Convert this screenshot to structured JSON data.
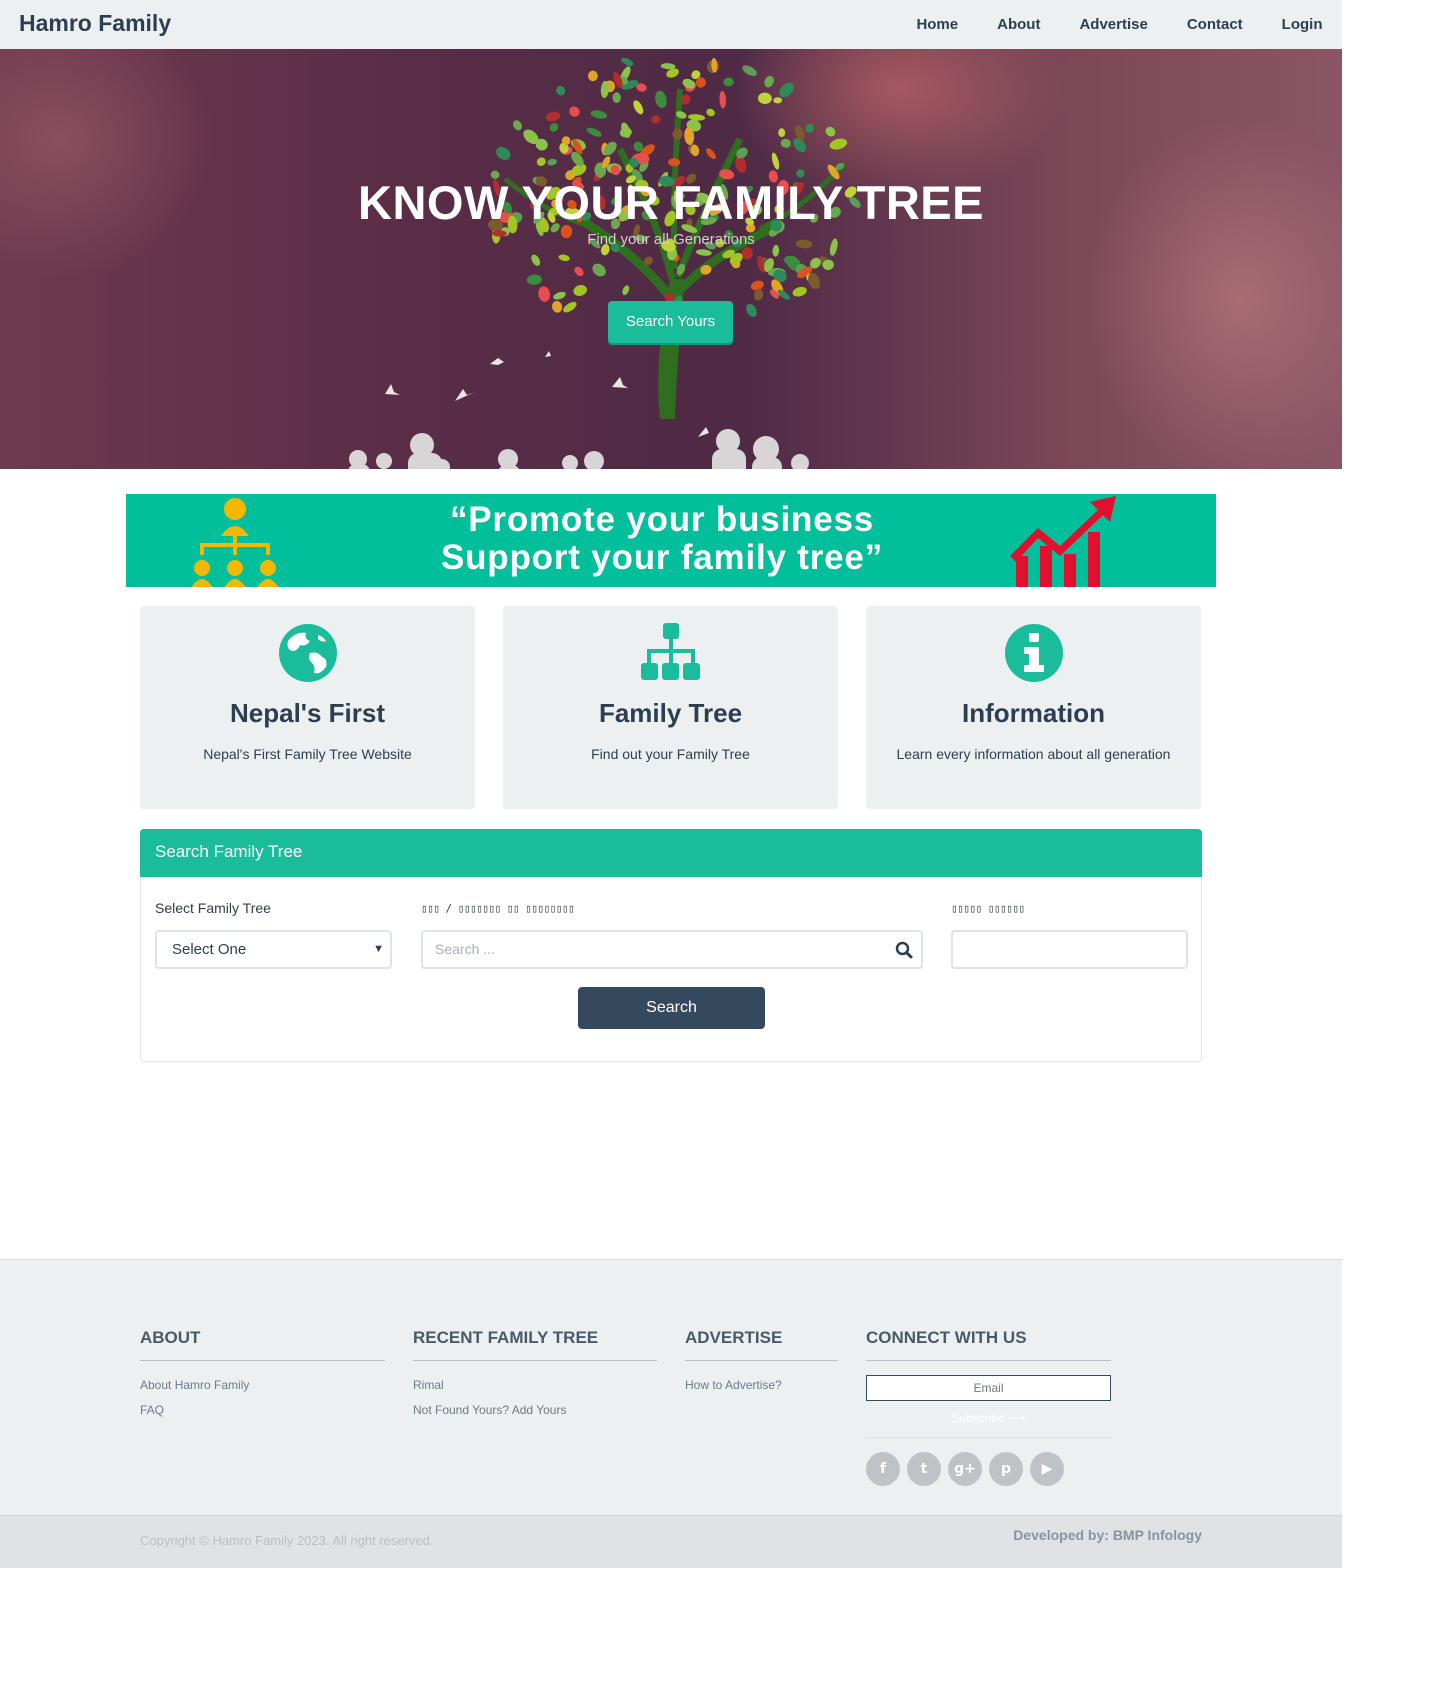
{
  "nav": {
    "brand": "Hamro Family",
    "links": [
      "Home",
      "About",
      "Advertise",
      "Contact",
      "Login"
    ]
  },
  "hero": {
    "title": "KNOW YOUR FAMILY TREE",
    "subtitle": "Find your all Generations",
    "button": "Search Yours"
  },
  "banner": {
    "line1": "“Promote your business",
    "line2": "Support your family tree”"
  },
  "features": [
    {
      "icon": "globe-icon",
      "title": "Nepal's First",
      "desc": "Nepal's First Family Tree Website"
    },
    {
      "icon": "sitemap-icon",
      "title": "Family Tree",
      "desc": "Find out your Family Tree"
    },
    {
      "icon": "info-icon",
      "title": "Information",
      "desc": "Learn every information about all generation"
    }
  ],
  "search_panel": {
    "heading": "Search Family Tree",
    "select_label": "Select Family Tree",
    "select_value": "Select One",
    "name_label": "▯▯▯ / ▯▯▯▯▯▯▯ ▯▯ ▯▯▯▯▯▯▯▯",
    "name_placeholder": "Search ...",
    "third_label": "▯▯▯▯▯ ▯▯▯▯▯▯",
    "button": "Search"
  },
  "footer": {
    "about": {
      "heading": "ABOUT",
      "links": [
        "About Hamro Family",
        "FAQ"
      ]
    },
    "recent": {
      "heading": "RECENT FAMILY TREE",
      "links": [
        "Rimal",
        "Not Found Yours? Add Yours"
      ]
    },
    "advertise": {
      "heading": "ADVERTISE",
      "links": [
        "How to Advertise?"
      ]
    },
    "connect": {
      "heading": "CONNECT WITH US",
      "email_placeholder": "Email",
      "subscribe": "Subscribe ⟶",
      "socials": [
        "facebook-icon",
        "twitter-icon",
        "google-plus-icon",
        "pinterest-icon",
        "youtube-icon"
      ]
    },
    "copyright": "Copyright © Hamro Family 2023. All right reserved.",
    "developer": "Developed by: BMP Infology"
  },
  "colors": {
    "accent": "#1bbc9b",
    "primary": "#2c3e50",
    "banner": "#00bf9a",
    "button_dark": "#34495e",
    "chart_red": "#e0102f",
    "people_yellow": "#f5b800"
  }
}
